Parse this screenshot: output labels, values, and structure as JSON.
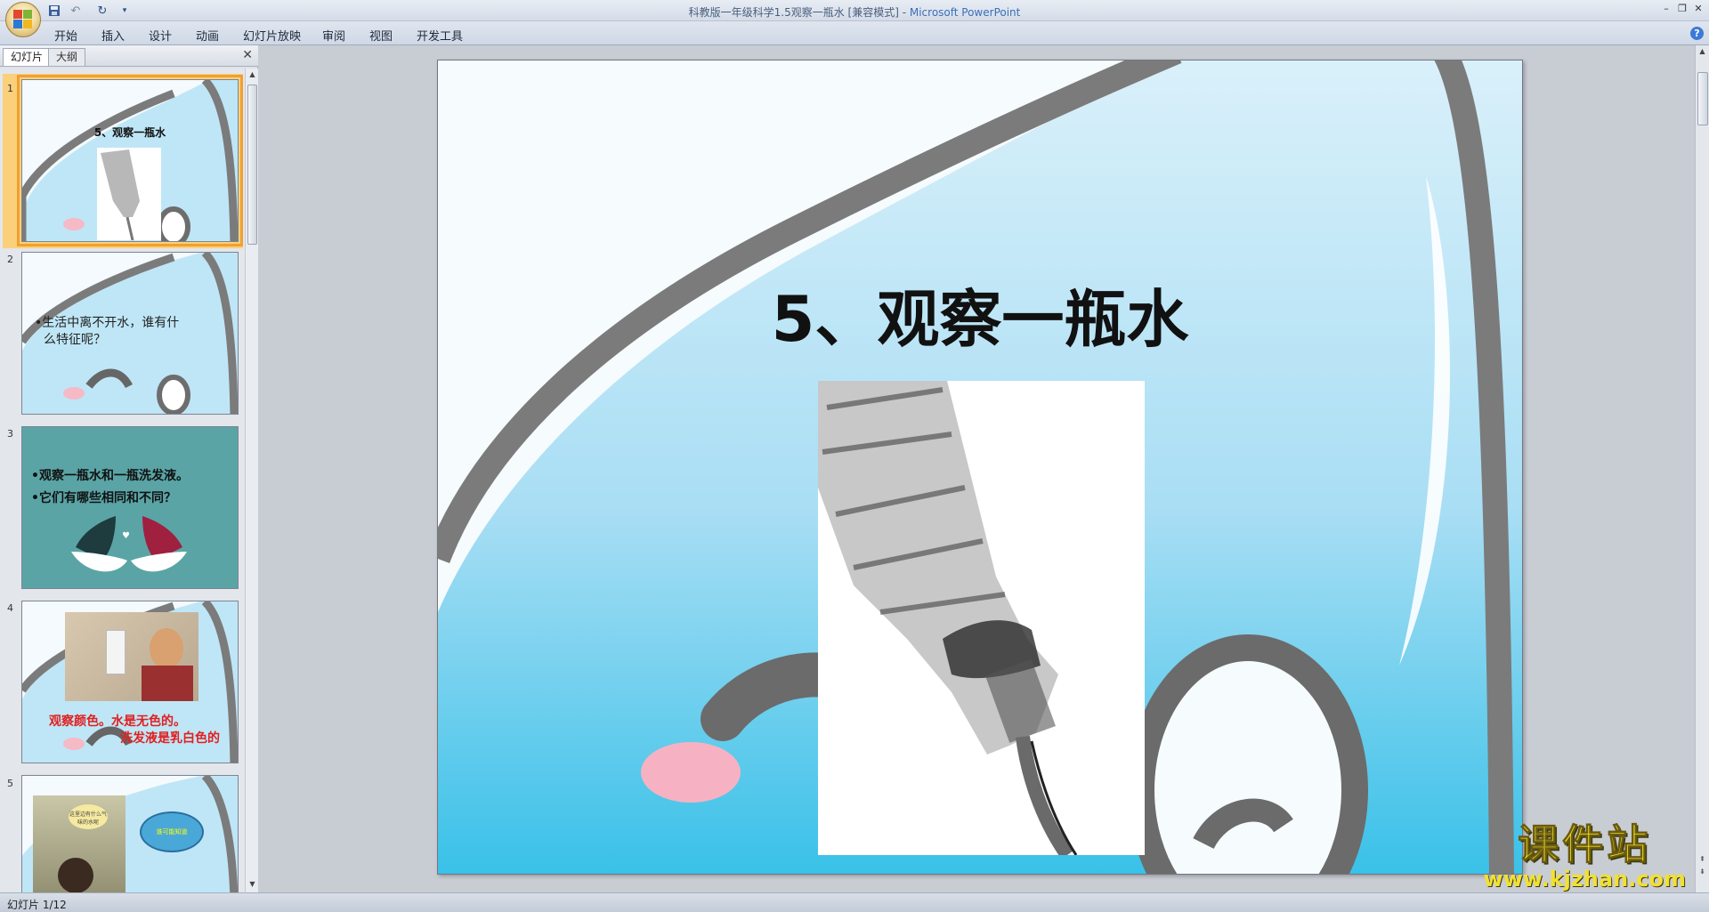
{
  "window": {
    "title_doc": "科教版一年级科学1.5观察一瓶水 [兼容模式]",
    "title_sep": " - ",
    "title_app": "Microsoft PowerPoint"
  },
  "ribbon": {
    "tabs": [
      "开始",
      "插入",
      "设计",
      "动画",
      "幻灯片放映",
      "审阅",
      "视图",
      "开发工具"
    ]
  },
  "panel": {
    "tab_slides": "幻灯片",
    "tab_outline": "大纲"
  },
  "thumbnails": [
    {
      "num": "1",
      "title": "5、观察一瓶水"
    },
    {
      "num": "2",
      "bullets": [
        "•生活中离不开水，谁有什",
        "么特征呢？"
      ]
    },
    {
      "num": "3",
      "bullets": [
        "•观察一瓶水和一瓶洗发液。",
        "•它们有哪些相同和不同？"
      ]
    },
    {
      "num": "4",
      "captions": [
        "观察颜色。水是无色的。",
        "洗发液是乳白色的"
      ]
    },
    {
      "num": "5",
      "bubbles": [
        "这里边有什么气味的水呢",
        "谁可能知道"
      ]
    }
  ],
  "slide": {
    "title": "5、观察一瓶水"
  },
  "status": {
    "text": "幻灯片 1/12"
  },
  "watermark": {
    "top": "课件站",
    "bottom": "www.kjzhan.com"
  },
  "colors": {
    "accent_selected": "#f0a030",
    "water_blue": "#8fd3f0",
    "outline_gray": "#7b7b7b",
    "slide3_bg": "#5aa4a6",
    "red_caption": "#e02020"
  }
}
